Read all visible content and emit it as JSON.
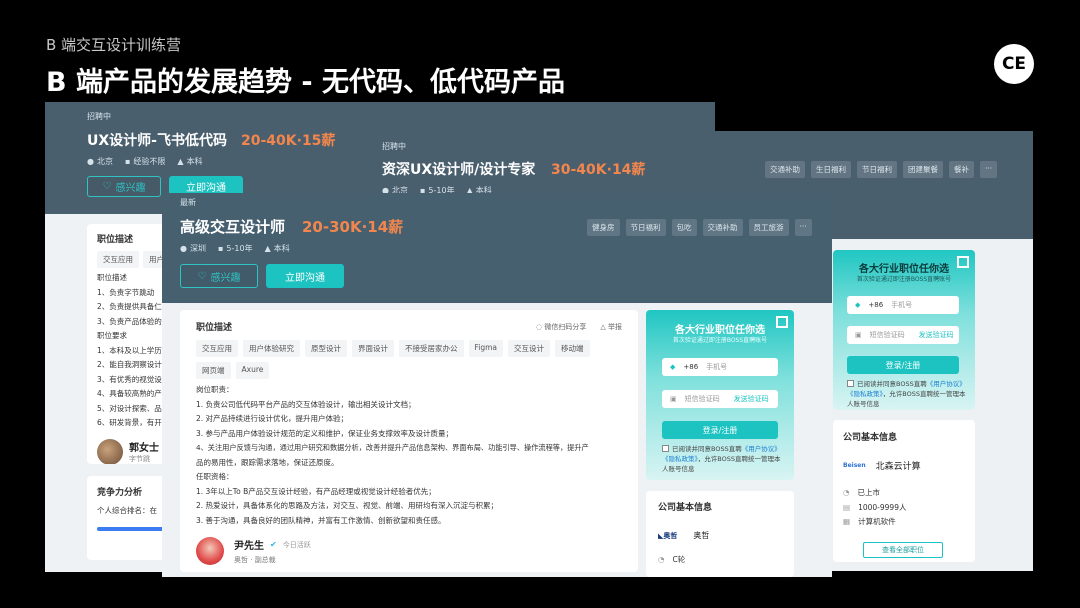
{
  "header": {
    "kicker": "B 端交互设计训练营",
    "title": "B 端产品的发展趋势 - 无代码、低代码产品",
    "logo": "CE"
  },
  "card_a": {
    "status": "招聘中",
    "title": "UX设计师-飞书低代码",
    "salary": "20-40K·15薪",
    "meta": [
      "北京",
      "经验不限",
      "本科"
    ],
    "interest": "感兴趣",
    "chat": "立即沟通",
    "desc_title": "职位描述",
    "chips": [
      "交互应用",
      "用户"
    ],
    "lines": [
      "职位描述",
      "1、负责字节跳动",
      "2、负责提供具备仁",
      "3、负责产品体验的",
      "职位要求",
      "1、本科及以上学历",
      "2、能自我洞察设计",
      "3、有优秀的视觉设",
      "4、具备较高熟的产",
      "5、对设计探索、品",
      "6、研发背景，有开"
    ],
    "person": "郭女士",
    "person_co": "字节跳",
    "compete_title": "竞争力分析",
    "compete_text": "个人综合排名：在"
  },
  "card_b": {
    "status": "招聘中",
    "title": "资深UX设计师/设计专家",
    "salary": "30-40K·14薪",
    "meta": [
      "北京",
      "5-10年",
      "本科"
    ],
    "tags": [
      "交通补助",
      "生日福利",
      "节日福利",
      "团建聚餐",
      "餐补",
      "···"
    ]
  },
  "card_c": {
    "status": "最新",
    "title": "高级交互设计师",
    "salary": "20-30K·14薪",
    "meta": [
      "深圳",
      "5-10年",
      "本科"
    ],
    "tags": [
      "健身房",
      "节日福利",
      "包吃",
      "交通补助",
      "员工旅游",
      "···"
    ],
    "interest": "感兴趣",
    "chat": "立即沟通",
    "desc_title": "职位描述",
    "share": "微信扫码分享",
    "report": "举报",
    "chips": [
      "交互应用",
      "用户体验研究",
      "原型设计",
      "界面设计",
      "不接受居家办公",
      "Figma",
      "交互设计",
      "移动端",
      "网页端",
      "Axure"
    ],
    "lines": [
      "岗位职责：",
      "1. 负责公司低代码平台产品的交互体验设计，输出相关设计文档；",
      "2. 对产品持续进行设计优化，提升用户体验；",
      "3. 参与产品用户体验设计规范的定义和维护，保证业务支撑效率及设计质量；",
      "4、关注用户反馈与沟通，通过用户研究和数据分析，改善并提升产品信息架构、界面布局、功能引导、操作流程等，提升产",
      "品的易用性，跟踪需求落地，保证还原度。",
      "任职资格：",
      "1. 3年以上To B产品交互设计经验，有产品经理或视觉设计经验者优先；",
      "2. 热爱设计，具备体系化的思路及方法，对交互、视觉、前端、用研均有深入沉淀与积累；",
      "3. 善于沟通，具备良好的团队精神，并富有工作激情、创新欲望和责任感。"
    ],
    "recruiter": "尹先生",
    "recruiter_status": "今日活跃",
    "recruiter_co": "奥哲",
    "recruiter_role": "副总裁",
    "login": {
      "title": "各大行业职位任你选",
      "sub": "首次验证通过即注册BOSS直聘账号",
      "code": "+86",
      "phone_ph": "手机号",
      "sms_ph": "短信验证码",
      "send": "发送验证码",
      "submit": "登录/注册",
      "agree1": "已阅读并同意BOSS直聘",
      "agree_link": "《用户协议》《隐私政策》",
      "agree2": "，允许BOSS直聘统一管理本人账号信息"
    },
    "company_title": "公司基本信息",
    "company_logo": "奥哲",
    "company_name": "奥哲",
    "company_stage": "C轮"
  },
  "card_d": {
    "login": {
      "title": "各大行业职位任你选",
      "sub": "首次验证通过即注册BOSS直聘账号",
      "code": "+86",
      "phone_ph": "手机号",
      "sms_ph": "短信验证码",
      "send": "发送验证码",
      "submit": "登录/注册",
      "agree1": "已阅读并同意BOSS直聘",
      "agree_link": "《用户协议》《隐私政策》",
      "agree2": "，允许BOSS直聘统一管理本人账号信息"
    },
    "company_title": "公司基本信息",
    "company_logo": "Beisen",
    "company_name": "北森云计算",
    "info": [
      "已上市",
      "1000-9999人",
      "计算机软件"
    ],
    "view_all": "查看全部职位"
  }
}
